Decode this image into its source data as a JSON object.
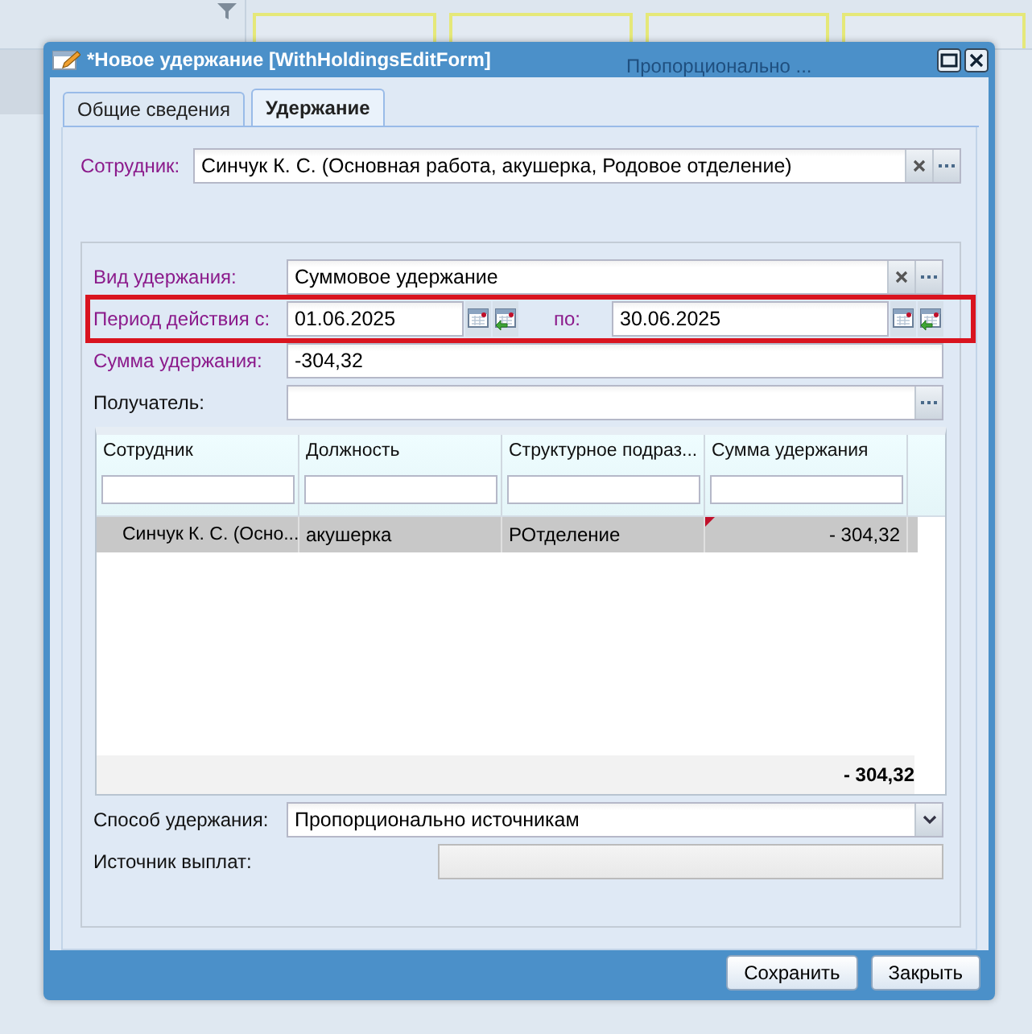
{
  "background_grid": {
    "overlapped_text": "Пропорционально ..."
  },
  "window": {
    "title": "*Новое удержание [WithHoldingsEditForm]"
  },
  "tabs": [
    {
      "label": "Общие сведения",
      "selected": false
    },
    {
      "label": "Удержание",
      "selected": true
    }
  ],
  "employee_field": {
    "label": "Сотрудник:",
    "value": "Синчук К. С. (Основная работа, акушерка, Родовое отделение)",
    "required": true
  },
  "fields": [
    {
      "kind": "lookup",
      "label": "Вид удержания:",
      "value": "Суммовое удержание",
      "required": true,
      "clearable": true
    },
    {
      "kind": "date_range",
      "label": "Период действия с:",
      "value": "01.06.2025",
      "to_label": "по:",
      "to_value": "30.06.2025",
      "required": true
    },
    {
      "kind": "text",
      "label": "Сумма удержания:",
      "value": "-304,32",
      "required": true
    },
    {
      "kind": "lookup",
      "label": "Получатель:",
      "required": false,
      "clearable": false
    }
  ],
  "grid": {
    "columns": [
      "Сотрудник",
      "Должность",
      "Структурное подраз...",
      "Сумма удержания"
    ],
    "rows": [
      {
        "selected": true,
        "cells": [
          {
            "text": "Синчук К. С. (Осно...",
            "modified": false
          },
          {
            "text": "акушерка",
            "modified": false
          },
          {
            "text": "РОтделение",
            "modified": false
          },
          {
            "text": "- 304,32",
            "modified": true
          }
        ]
      }
    ],
    "total": "- 304,32"
  },
  "bottom_fields": [
    {
      "kind": "combo",
      "label": "Способ удержания:",
      "value": "Пропорционально источникам",
      "disabled": false
    },
    {
      "kind": "text",
      "label": "Источник выплат:",
      "disabled": true
    }
  ],
  "buttons": [
    {
      "label": "Сохранить"
    },
    {
      "label": "Закрыть"
    }
  ]
}
